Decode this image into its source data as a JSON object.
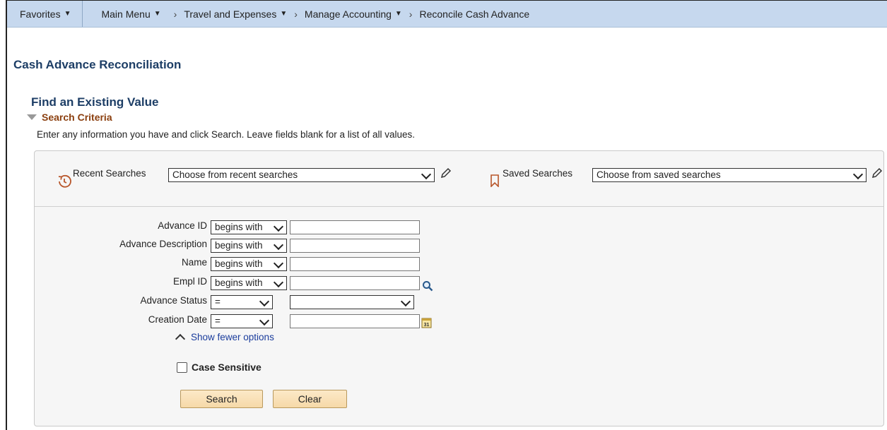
{
  "nav": {
    "favorites": "Favorites",
    "main_menu": "Main Menu",
    "crumb1": "Travel and Expenses",
    "crumb2": "Manage Accounting",
    "crumb3": "Reconcile Cash Advance"
  },
  "page": {
    "title": "Cash Advance Reconciliation",
    "find_title": "Find an Existing Value",
    "search_criteria": "Search Criteria",
    "instructions": "Enter any information you have and click Search. Leave fields blank for a list of all values."
  },
  "searches": {
    "recent_label": "Recent Searches",
    "recent_value": "Choose from recent searches",
    "saved_label": "Saved Searches",
    "saved_value": "Choose from saved searches"
  },
  "fields": [
    {
      "label": "Advance ID",
      "operator": "begins with",
      "value": ""
    },
    {
      "label": "Advance Description",
      "operator": "begins with",
      "value": ""
    },
    {
      "label": "Name",
      "operator": "begins with",
      "value": ""
    },
    {
      "label": "Empl ID",
      "operator": "begins with",
      "value": ""
    },
    {
      "label": "Advance Status",
      "operator": "=",
      "value": ""
    },
    {
      "label": "Creation Date",
      "operator": "=",
      "value": ""
    }
  ],
  "options": {
    "show_fewer": "Show fewer options",
    "case_sensitive": "Case Sensitive",
    "case_sensitive_checked": false
  },
  "buttons": {
    "search": "Search",
    "clear": "Clear",
    "accent": "#f6d9a8"
  },
  "icons": {
    "recent": "history-icon",
    "saved": "bookmark-icon",
    "edit": "pencil-icon",
    "lookup": "magnifier-icon",
    "calendar": "calendar-icon"
  }
}
